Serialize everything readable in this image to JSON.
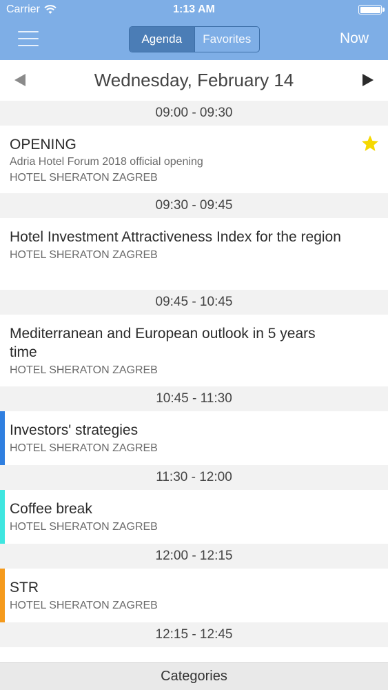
{
  "status_bar": {
    "carrier": "Carrier",
    "time": "1:13 AM",
    "battery_level": 1.0
  },
  "nav": {
    "segments": [
      "Agenda",
      "Favorites"
    ],
    "active_segment": "Agenda",
    "now_label": "Now"
  },
  "date": {
    "label": "Wednesday, February 14"
  },
  "colors": {
    "header": "#7eaee6",
    "segment_active": "#4b7db6",
    "star": "#f5d800"
  },
  "agenda": [
    {
      "time": "09:00 - 09:30",
      "title": "OPENING",
      "subtitle": "Adria Hotel Forum 2018 official opening",
      "venue": "HOTEL SHERATON ZAGREB",
      "favorite": true,
      "accent": ""
    },
    {
      "time": "09:30 - 09:45",
      "title": "Hotel Investment Attractiveness Index for the region",
      "venue": "HOTEL SHERATON ZAGREB",
      "favorite": false,
      "accent": ""
    },
    {
      "time": "09:45 - 10:45",
      "title": "Mediterranean and European outlook in 5 years time",
      "venue": "HOTEL SHERATON ZAGREB",
      "favorite": false,
      "accent": ""
    },
    {
      "time": "10:45 - 11:30",
      "title": "Investors' strategies",
      "venue": "HOTEL SHERATON ZAGREB",
      "favorite": false,
      "accent": "#2f7fe0"
    },
    {
      "time": "11:30 - 12:00",
      "title": "Coffee break",
      "venue": "HOTEL SHERATON ZAGREB",
      "favorite": false,
      "accent": "#3fe6e0"
    },
    {
      "time": "12:00 - 12:15",
      "title": "STR",
      "venue": "HOTEL SHERATON ZAGREB",
      "favorite": false,
      "accent": "#f59a1c"
    },
    {
      "time": "12:15 - 12:45"
    }
  ],
  "bottom_bar": {
    "label": "Categories"
  }
}
